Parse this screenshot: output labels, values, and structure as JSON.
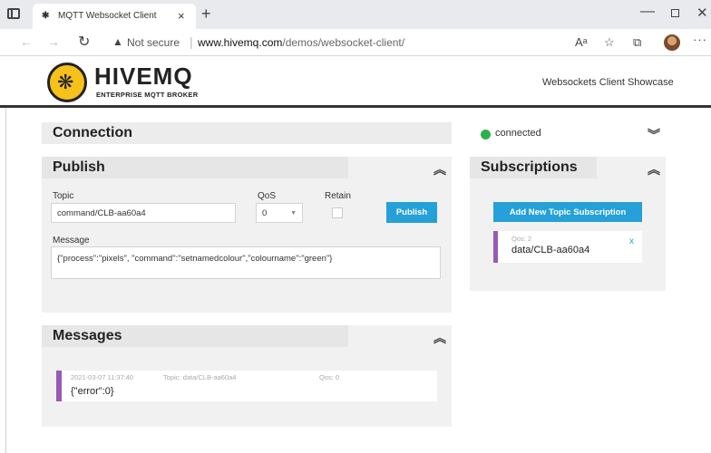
{
  "browser": {
    "tab_title": "MQTT Websocket Client",
    "tab_close": "×",
    "new_tab": "+",
    "security_label": "Not secure",
    "url_host": "www.hivemq.com",
    "url_path": "/demos/websocket-client/"
  },
  "header": {
    "brand": "HIVEMQ",
    "brand_sub": "ENTERPRISE MQTT BROKER",
    "showcase": "Websockets Client Showcase"
  },
  "connection": {
    "title": "Connection",
    "status": "connected",
    "status_color": "#2db04a"
  },
  "publish": {
    "title": "Publish",
    "topic_label": "Topic",
    "topic_value": "command/CLB-aa60a4",
    "qos_label": "QoS",
    "qos_value": "0",
    "retain_label": "Retain",
    "publish_button": "Publish",
    "message_label": "Message",
    "message_value": "{\"process\":\"pixels\", \"command\":\"setnamedcolour\",\"colourname\":\"green\"}"
  },
  "subscriptions": {
    "title": "Subscriptions",
    "add_button": "Add New Topic Subscription",
    "items": [
      {
        "qos": "Qos: 2",
        "topic": "data/CLB-aa60a4",
        "remove": "x",
        "color": "#9a59b5"
      }
    ]
  },
  "messages": {
    "title": "Messages",
    "items": [
      {
        "timestamp": "2021-03-07 11:37:40",
        "topic": "Topic: data/CLB-aa60a4",
        "qos": "Qos: 0",
        "payload": "{\"error\":0}",
        "color": "#9a59b5"
      }
    ]
  },
  "accent_color": "#26a0d8",
  "icons": [
    "sidebar-icon",
    "favicon-icon",
    "back-icon",
    "forward-icon",
    "reload-icon",
    "warning-icon",
    "read-aloud-icon",
    "favorites-icon",
    "collections-icon",
    "profile-icon",
    "more-icon",
    "chevron-up-icon",
    "chevron-down-icon",
    "close-icon",
    "bee-icon"
  ]
}
